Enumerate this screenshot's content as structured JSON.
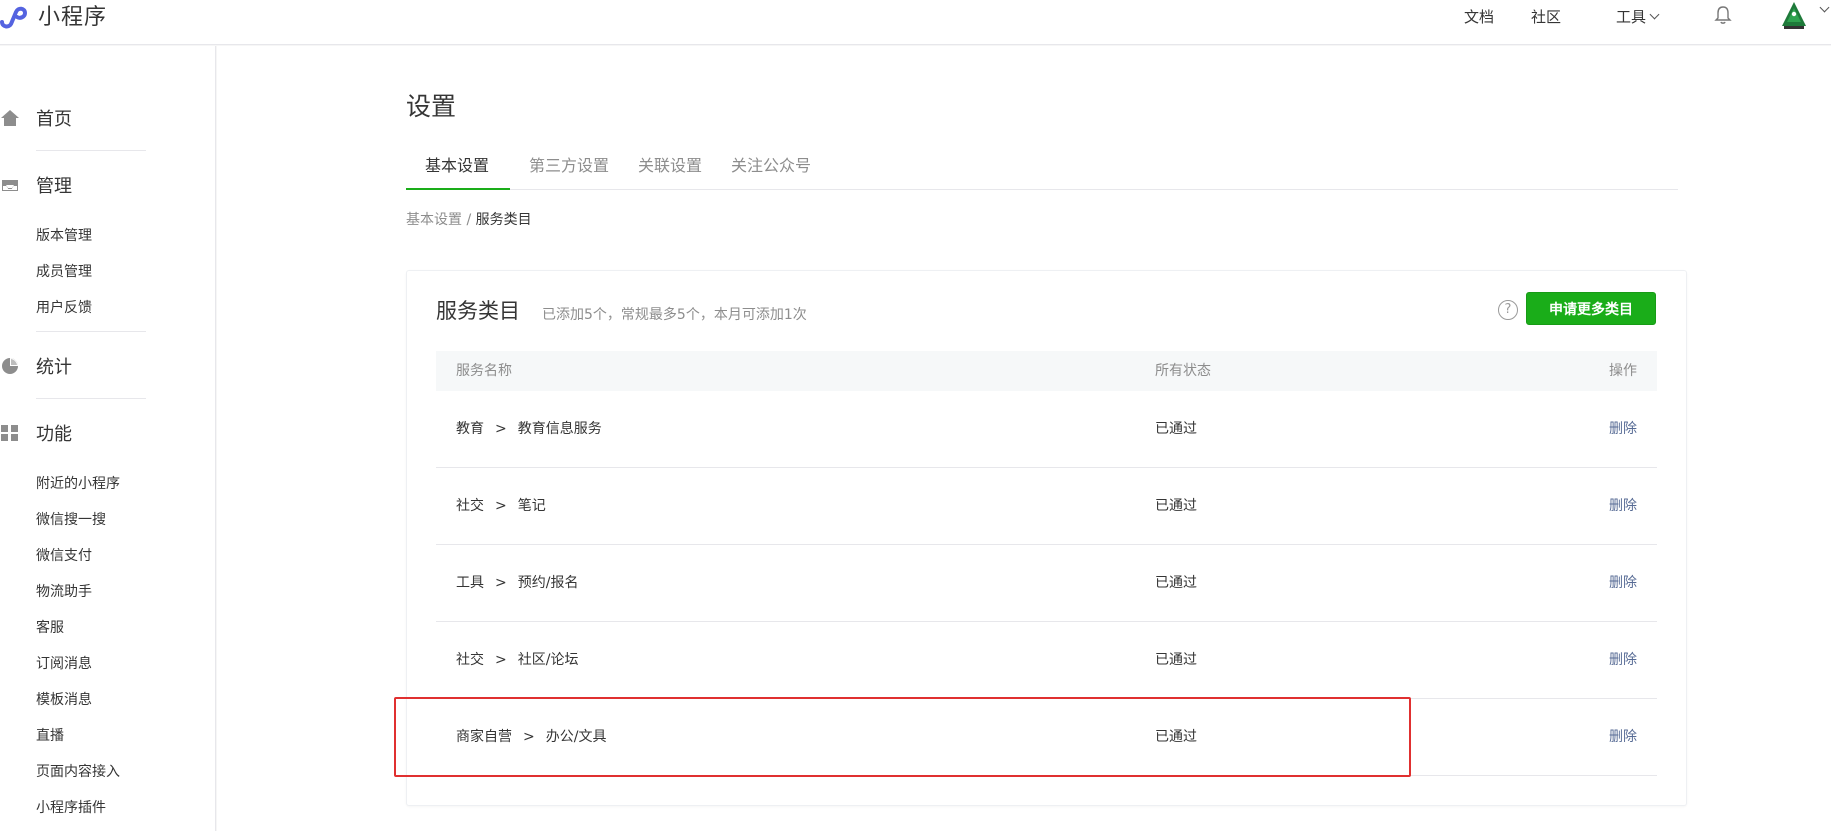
{
  "app": {
    "name": "小程序",
    "tm": "™"
  },
  "topnav": {
    "docs": "文档",
    "community": "社区",
    "tools": "工具"
  },
  "sidebar": {
    "groups": [
      {
        "label": "首页",
        "icon": "home-icon"
      },
      {
        "label": "管理",
        "icon": "inbox-icon",
        "items": [
          "版本管理",
          "成员管理",
          "用户反馈"
        ]
      },
      {
        "label": "统计",
        "icon": "pie-chart-icon"
      },
      {
        "label": "功能",
        "icon": "grid-icon",
        "items": [
          "附近的小程序",
          "微信搜一搜",
          "微信支付",
          "物流助手",
          "客服",
          "订阅消息",
          "模板消息",
          "直播",
          "页面内容接入",
          "小程序插件"
        ]
      }
    ]
  },
  "page": {
    "title": "设置",
    "tabs": [
      "基本设置",
      "第三方设置",
      "关联设置",
      "关注公众号"
    ],
    "breadcrumb": {
      "parent": "基本设置",
      "separator": "/",
      "current": "服务类目"
    }
  },
  "card": {
    "title": "服务类目",
    "subtitle": "已添加5个，常规最多5个，本月可添加1次",
    "help": "?",
    "apply_button": "申请更多类目",
    "columns": {
      "name": "服务名称",
      "status": "所有状态",
      "action": "操作"
    },
    "rows": [
      {
        "category": "教育",
        "sub": "教育信息服务",
        "status": "已通过",
        "action": "删除"
      },
      {
        "category": "社交",
        "sub": "笔记",
        "status": "已通过",
        "action": "删除"
      },
      {
        "category": "工具",
        "sub": "预约/报名",
        "status": "已通过",
        "action": "删除"
      },
      {
        "category": "社交",
        "sub": "社区/论坛",
        "status": "已通过",
        "action": "删除"
      },
      {
        "category": "商家自营",
        "sub": "办公/文具",
        "status": "已通过",
        "action": "删除"
      }
    ],
    "arrow": ">"
  },
  "colors": {
    "accent": "#1aad19",
    "link": "#576b95",
    "highlight": "#e03030"
  }
}
